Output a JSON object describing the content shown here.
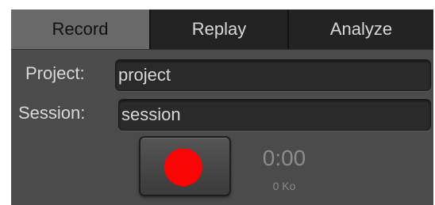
{
  "tabs": [
    {
      "label": "Record",
      "active": true
    },
    {
      "label": "Replay",
      "active": false
    },
    {
      "label": "Analyze",
      "active": false
    }
  ],
  "form": {
    "project_label": "Project:",
    "project_value": "project",
    "session_label": "Session:",
    "session_value": "session"
  },
  "recorder": {
    "record_icon": "record-circle-icon",
    "record_color": "#fa0505",
    "elapsed_time": "0:00",
    "data_size": "0 Ko"
  },
  "colors": {
    "panel_bg": "#4b4b4b",
    "tab_inactive_bg": "#232323",
    "tab_active_bg": "#696969",
    "field_bg": "#2a2a2a",
    "text": "#d9d9d9"
  }
}
